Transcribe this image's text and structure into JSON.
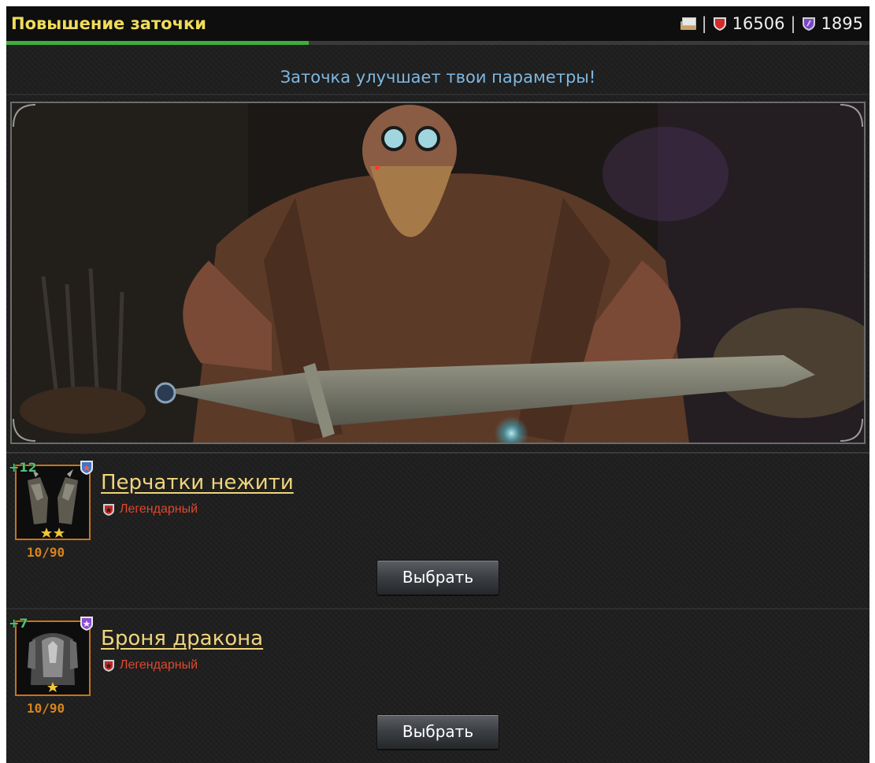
{
  "header": {
    "title": "Повышение заточки",
    "progress": 0.35,
    "separator": "|",
    "currency_red": "16506",
    "currency_purple": "1895"
  },
  "subtitle": "Заточка улучшает твои параметры!",
  "items": [
    {
      "level": "+12",
      "name": "Перчатки нежити",
      "rarity": "Легендарный",
      "count": "10/90",
      "stars": 2,
      "button_label": "Выбрать"
    },
    {
      "level": "+7",
      "name": "Броня дракона",
      "rarity": "Легендарный",
      "count": "10/90",
      "stars": 1,
      "button_label": "Выбрать"
    }
  ],
  "colors": {
    "title": "#f0dc5a",
    "subtitle": "#7fb7e0",
    "item_name": "#f0d57c",
    "rarity": "#e0482e",
    "progress": "#3fae3c"
  },
  "icons": [
    "mail-icon",
    "red-shield-icon",
    "purple-shield-icon",
    "blue-rank-badge-icon",
    "purple-rank-badge-icon",
    "legendary-rarity-icon"
  ]
}
